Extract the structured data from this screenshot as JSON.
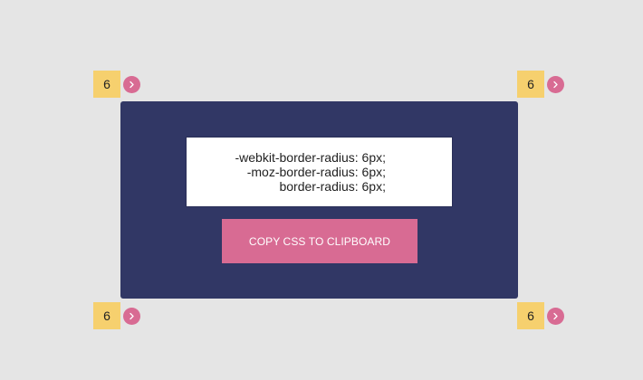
{
  "css_output": {
    "lines": [
      "-webkit-border-radius: 6px;",
      "-moz-border-radius: 6px;",
      "border-radius: 6px;"
    ]
  },
  "copy_button": {
    "label": "COPY CSS TO CLIPBOARD"
  },
  "corners": {
    "top_left": {
      "value": "6",
      "arrow_icon": "chevron-right-icon"
    },
    "top_right": {
      "value": "6",
      "arrow_icon": "chevron-right-icon"
    },
    "bottom_left": {
      "value": "6",
      "arrow_icon": "chevron-right-icon"
    },
    "bottom_right": {
      "value": "6",
      "arrow_icon": "chevron-right-icon"
    }
  },
  "colors": {
    "background": "#e5e5e5",
    "preview_box": "#313765",
    "accent": "#d86b93",
    "value_badge": "#f6d06e"
  }
}
